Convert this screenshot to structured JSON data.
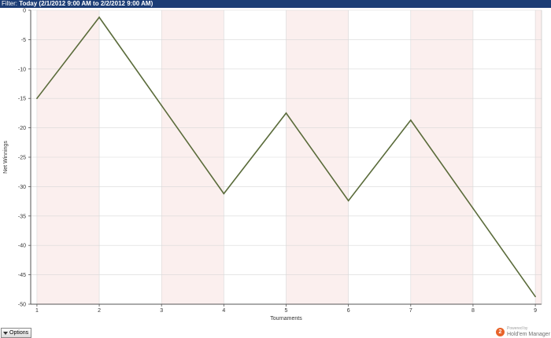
{
  "filter": {
    "label": "Filter:",
    "value": "Today (2/1/2012 9:00 AM to 2/2/2012 9:00 AM)"
  },
  "options_button": {
    "label": "Options"
  },
  "brand": {
    "powered_by": "Powered by",
    "name": "Hold'em Manager",
    "icon_glyph": "2"
  },
  "colors": {
    "filter_bar": "#1c3d75",
    "line": "#5a6b3a",
    "band": "#fbefee",
    "grid": "#d8d8d8"
  },
  "chart_data": {
    "type": "line",
    "xlabel": "Tournaments",
    "ylabel": "Net Winnings",
    "x": [
      1,
      2,
      3,
      4,
      5,
      6,
      7,
      8,
      9
    ],
    "series": [
      {
        "values": [
          -15,
          -1.2,
          -16.2,
          -31.2,
          -17.5,
          -32.4,
          -18.7,
          -33.7,
          -48.7
        ]
      }
    ],
    "xlim": [
      0.9,
      9.1
    ],
    "ylim": [
      -50,
      0
    ],
    "yticks": [
      0,
      -5,
      -10,
      -15,
      -20,
      -25,
      -30,
      -35,
      -40,
      -45,
      -50
    ],
    "xticks": [
      1,
      2,
      3,
      4,
      5,
      6,
      7,
      8,
      9
    ],
    "grid": true
  }
}
